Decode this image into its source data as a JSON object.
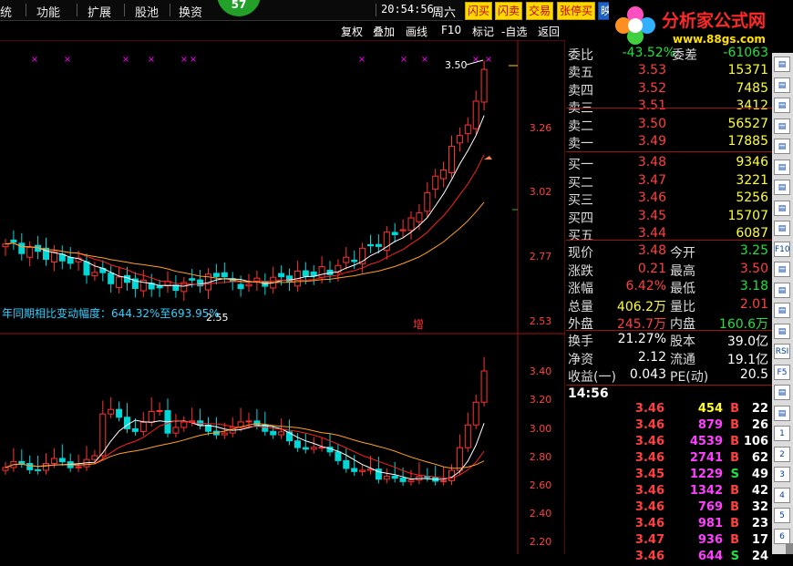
{
  "menubar": {
    "items": [
      "统",
      "功能",
      "扩展",
      "股池",
      "换资"
    ],
    "badge": "57",
    "clock": "20:54:56",
    "weekday": "周六",
    "trade_buttons": [
      "闪买",
      "闪卖",
      "交易",
      "张停买",
      "映"
    ]
  },
  "logo": {
    "text": "分析家公式网",
    "url": "www.88gs.com"
  },
  "toolbar": {
    "items": [
      "复权",
      "叠加",
      "画线",
      "F10",
      "标记",
      "-自选",
      "返回"
    ]
  },
  "chart": {
    "upper_price_labels": [
      "3.26",
      "3.02",
      "2.77",
      "2.53"
    ],
    "lower_price_labels": [
      "3.40",
      "3.20",
      "3.00",
      "2.80",
      "2.60",
      "2.40",
      "2.20"
    ],
    "high_marker": "3.50",
    "low_marker": "2.55",
    "annotation": "年同期相比变动幅度：644.32%至693.95%",
    "zeng_label": "增",
    "colors": {
      "up": "#ff3232",
      "down": "#00d8d8",
      "ma_white": "#ffffff",
      "ma_red": "#ff2020",
      "ma_orange": "#ffa020",
      "x_marker": "#ff00ff"
    }
  },
  "quote": {
    "weibi": {
      "label": "委比",
      "value": "-43.52%",
      "label2": "委差",
      "value2": "-61063"
    },
    "sell": [
      {
        "label": "卖五",
        "price": "3.53",
        "vol": "15371"
      },
      {
        "label": "卖四",
        "price": "3.52",
        "vol": "7485"
      },
      {
        "label": "卖三",
        "price": "3.51",
        "vol": "3412"
      },
      {
        "label": "卖二",
        "price": "3.50",
        "vol": "56527"
      },
      {
        "label": "卖一",
        "price": "3.49",
        "vol": "17885"
      }
    ],
    "buy": [
      {
        "label": "买一",
        "price": "3.48",
        "vol": "9346"
      },
      {
        "label": "买二",
        "price": "3.47",
        "vol": "3221"
      },
      {
        "label": "买三",
        "price": "3.46",
        "vol": "5256"
      },
      {
        "label": "买四",
        "price": "3.45",
        "vol": "15707"
      },
      {
        "label": "买五",
        "price": "3.44",
        "vol": "6087"
      }
    ],
    "stats": [
      {
        "l1": "现价",
        "v1": "3.48",
        "c1": "red",
        "l2": "今开",
        "v2": "3.25",
        "c2": "green"
      },
      {
        "l1": "涨跌",
        "v1": "0.21",
        "c1": "red",
        "l2": "最高",
        "v2": "3.50",
        "c2": "red"
      },
      {
        "l1": "涨幅",
        "v1": "6.42%",
        "c1": "red",
        "l2": "最低",
        "v2": "3.18",
        "c2": "green"
      },
      {
        "l1": "总量",
        "v1": "406.2万",
        "c1": "yellow",
        "l2": "量比",
        "v2": "2.01",
        "c2": "red"
      },
      {
        "l1": "外盘",
        "v1": "245.7万",
        "c1": "red",
        "l2": "内盘",
        "v2": "160.6万",
        "c2": "green"
      }
    ],
    "stats2": [
      {
        "l1": "换手",
        "v1": "21.27%",
        "l2": "股本",
        "v2": "39.0亿"
      },
      {
        "l1": "净资",
        "v1": "2.12",
        "l2": "流通",
        "v2": "19.1亿"
      },
      {
        "l1": "收益(一)",
        "v1": "0.043",
        "l2": "PE(动)",
        "v2": "20.5"
      }
    ]
  },
  "trades": {
    "time": "14:56",
    "rows": [
      {
        "price": "3.46",
        "vol": "454",
        "vc": "yellow",
        "side": "B",
        "n": "22"
      },
      {
        "price": "3.46",
        "vol": "879",
        "vc": "magenta",
        "side": "B",
        "n": "26"
      },
      {
        "price": "3.46",
        "vol": "4539",
        "vc": "magenta",
        "side": "B",
        "n": "106"
      },
      {
        "price": "3.46",
        "vol": "2741",
        "vc": "magenta",
        "side": "B",
        "n": "62"
      },
      {
        "price": "3.45",
        "vol": "1229",
        "vc": "magenta",
        "side": "S",
        "n": "49"
      },
      {
        "price": "3.46",
        "vol": "1342",
        "vc": "magenta",
        "side": "B",
        "n": "42"
      },
      {
        "price": "3.46",
        "vol": "769",
        "vc": "magenta",
        "side": "B",
        "n": "32"
      },
      {
        "price": "3.46",
        "vol": "981",
        "vc": "magenta",
        "side": "B",
        "n": "23"
      },
      {
        "price": "3.47",
        "vol": "936",
        "vc": "magenta",
        "side": "B",
        "n": "17"
      },
      {
        "price": "3.46",
        "vol": "644",
        "vc": "magenta",
        "side": "S",
        "n": "24"
      }
    ]
  },
  "sidebar": {
    "icons": [
      "F10",
      "RSI",
      "F5",
      "1",
      "2",
      "3",
      "4",
      "5",
      "6"
    ]
  }
}
